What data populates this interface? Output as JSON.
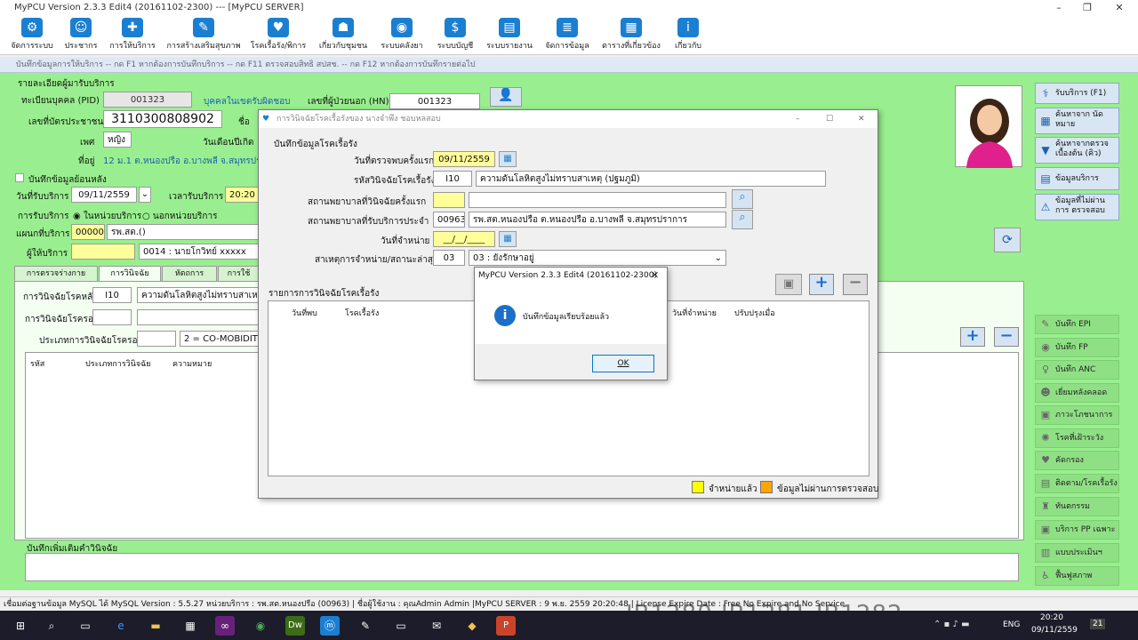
{
  "app_title": "MyPCU Version 2.3.3 Edit4 (20161102-2300) --- [MyPCU SERVER]",
  "toolbar": [
    {
      "label": "จัดการระบบ",
      "icon": "gear-icon"
    },
    {
      "label": "ประชากร",
      "icon": "people-icon"
    },
    {
      "label": "การให้บริการ",
      "icon": "medical-bag-icon"
    },
    {
      "label": "การสร้างเสริมสุขภาพ",
      "icon": "syringe-icon"
    },
    {
      "label": "โรคเรื้อรัง/พิการ",
      "icon": "heartbeat-icon"
    },
    {
      "label": "เกี่ยวกับชุมชน",
      "icon": "community-icon"
    },
    {
      "label": "ระบบคลังยา",
      "icon": "pill-icon"
    },
    {
      "label": "ระบบบัญชี",
      "icon": "money-icon"
    },
    {
      "label": "ระบบรายงาน",
      "icon": "chart-icon"
    },
    {
      "label": "จัดการข้อมูล",
      "icon": "database-icon"
    },
    {
      "label": "ตารางที่เกี่ยวข้อง",
      "icon": "calculator-icon"
    },
    {
      "label": "เกี่ยวกับ",
      "icon": "info-icon"
    }
  ],
  "child_title": "บันทึกข้อมูลการให้บริการ -- กด F1 หากต้องการบันทึกบริการ -- กด F11 ตรวจสอบสิทธิ สปสช. -- กด F12 หากต้องการบันทึกรายต่อไป",
  "main": {
    "section_title": "รายละเอียดผู้มารับบริการ",
    "pid_label": "ทะเบียนบุคคล (PID)",
    "pid_value": "001323",
    "in_area_link": "บุคคลในเขตรับผิดชอบ",
    "hn_label": "เลขที่ผู้ป่วยนอก (HN)",
    "hn_value": "001323",
    "cid_label": "เลขที่บัตรประชาชน",
    "cid_value": "3110300808902",
    "name_label": "ชื่อ",
    "sex_label": "เพศ",
    "sex_value": "หญิง",
    "birth_label": "วันเดือนปีเกิด",
    "address_label": "ที่อยู่",
    "address_value": "12 ม.1 ต.หนองปรือ อ.บางพลี จ.สมุทรปราก",
    "backdate_label": "บันทึกข้อมูลย้อนหลัง",
    "service_date_label": "วันที่รับบริการ",
    "service_date_value": "09/11/2559",
    "service_time_label": "เวลารับบริการ",
    "service_time_value": "20:20",
    "service_type_label": "การรับบริการ",
    "in_unit_label": "ในหน่วยบริการ",
    "out_unit_label": "นอกหน่วยบริการ",
    "dept_label": "แผนกที่บริการ",
    "dept_code": "00000",
    "dept_name": "รพ.สต.()",
    "provider_label": "ผู้ให้บริการ",
    "provider_value": "0014 : นายโกวิทย์ xxxxx",
    "tabs": [
      "การตรวจร่างกาย (F2)",
      "การวินิจฉัย (F3)",
      "หัตถการ (F4)",
      "การใช้ยา/"
    ],
    "dx_main_label": "การวินิจฉัยโรคหลัก",
    "dx_main_code": "I10",
    "dx_main_name": "ความดันโลหิตสูงไม่ทราบสาเหตุ (ปฐมภูมิ",
    "dx_minor_label": "การวินิจฉัยโรครอง",
    "dx_type_label": "ประเภทการวินิจฉัยโรครอง",
    "dx_type_value": "2 = CO-MOBIDITY (",
    "dx_table_headers": [
      "รหัส",
      "ประเภทการวินิจฉัย",
      "ความหมาย"
    ],
    "note_label": "บันทึกเพิ่มเติมคำวินิจฉัย"
  },
  "side_buttons": [
    {
      "label": "รับบริการ (F1)",
      "icon": "stethoscope-icon"
    },
    {
      "label": "ค้นหาจาก นัดหมาย",
      "icon": "calendar-icon"
    },
    {
      "label": "ค้นหาจากตรวจ เบื้องต้น (คิว)",
      "icon": "filter-icon"
    },
    {
      "label": "ข้อมูลบริการ",
      "icon": "clipboard-icon"
    },
    {
      "label": "ข้อมูลที่ไม่ผ่านการ ตรวจสอบ",
      "icon": "warning-icon"
    }
  ],
  "green_buttons": [
    {
      "label": "บันทึก EPI",
      "icon": "syringe-icon"
    },
    {
      "label": "บันทึก FP",
      "icon": "pill-icon"
    },
    {
      "label": "บันทึก ANC",
      "icon": "pregnant-icon"
    },
    {
      "label": "เยี่ยมหลังคลอด",
      "icon": "baby-icon"
    },
    {
      "label": "ภาวะโภชนาการ",
      "icon": "scale-icon"
    },
    {
      "label": "โรคที่เฝ้าระวัง",
      "icon": "virus-icon"
    },
    {
      "label": "คัดกรอง",
      "icon": "heart-icon"
    },
    {
      "label": "ติดตาม/โรคเรื้อรัง",
      "icon": "clipboard-icon"
    },
    {
      "label": "ทันตกรรม",
      "icon": "tooth-icon"
    },
    {
      "label": "บริการ PP เฉพาะ",
      "icon": "bag-icon"
    },
    {
      "label": "แบบประเมินฯ",
      "icon": "form-icon"
    },
    {
      "label": "ฟื้นฟูสภาพ",
      "icon": "wheelchair-icon"
    }
  ],
  "chronic_dialog": {
    "title": "การวินิจฉัยโรคเรื้อรังของ นางจำพึง ชอบหลสอบ",
    "group_title": "บันทึกข้อมูลโรคเรื้อรัง",
    "first_date_label": "วันที่ตรวจพบครั้งแรก",
    "first_date_value": "09/11/2559",
    "code_label": "รหัสวินิจฉัยโรคเรื้อรัง",
    "code_value": "I10",
    "code_name": "ความดันโลหิตสูงไม่ทราบสาเหตุ (ปฐมภูมิ)",
    "first_hosp_label": "สถานพยาบาลที่วินิจฉัยครั้งแรก",
    "regular_hosp_label": "สถานพยาบาลที่รับบริการประจำ",
    "regular_hosp_code": "00963",
    "regular_hosp_name": "รพ.สต.หนองปรือ ต.หนองปรือ อ.บางพลี จ.สมุทรปราการ",
    "discharge_label": "วันที่จำหน่าย",
    "discharge_value": "__/__/____",
    "status_label": "สาเหตุการจำหน่าย/สถานะล่าสุด",
    "status_code": "03",
    "status_value": "03 : ยังรักษาอยู่",
    "list_title": "รายการการวินิจฉัยโรคเรื้อรัง",
    "list_headers": [
      "วันที่พบ",
      "โรคเรื้อรัง",
      "วันที่จำหน่าย",
      "ปรับปรุงเมื่อ"
    ],
    "legend_discharged": "จำหน่ายแล้ว",
    "legend_invalid": "ข้อมูลไม่ผ่านการตรวจสอบ"
  },
  "msgbox": {
    "title": "MyPCU Version 2.3.3 Edit4 (20161102-2300)",
    "message": "บันทึกข้อมูลเรียบร้อยแล้ว",
    "ok": "OK"
  },
  "status_bar": "เชื่อมต่อฐานข้อมูล MySQL ได้    MySQL Version : 5.5.27  หน่วยบริการ : รพ.สต.หนองปรือ (00963)  | ชื่อผู้ใช้งาน : คุณAdmin Admin   |MyPCU SERVER : 9 พ.ย. 2559 20:20:48   | License Expire Date : Free  No Expire and No Service",
  "watermark": "IB1280,IB1281,IB1282",
  "taskbar": {
    "lang": "ENG",
    "time": "20:20",
    "date": "09/11/2559",
    "badge": "21"
  },
  "colors": {
    "green_bg": "#99ef8f",
    "yellow": "#ffff00",
    "orange": "#ffa500",
    "accent": "#1b7fd1"
  }
}
